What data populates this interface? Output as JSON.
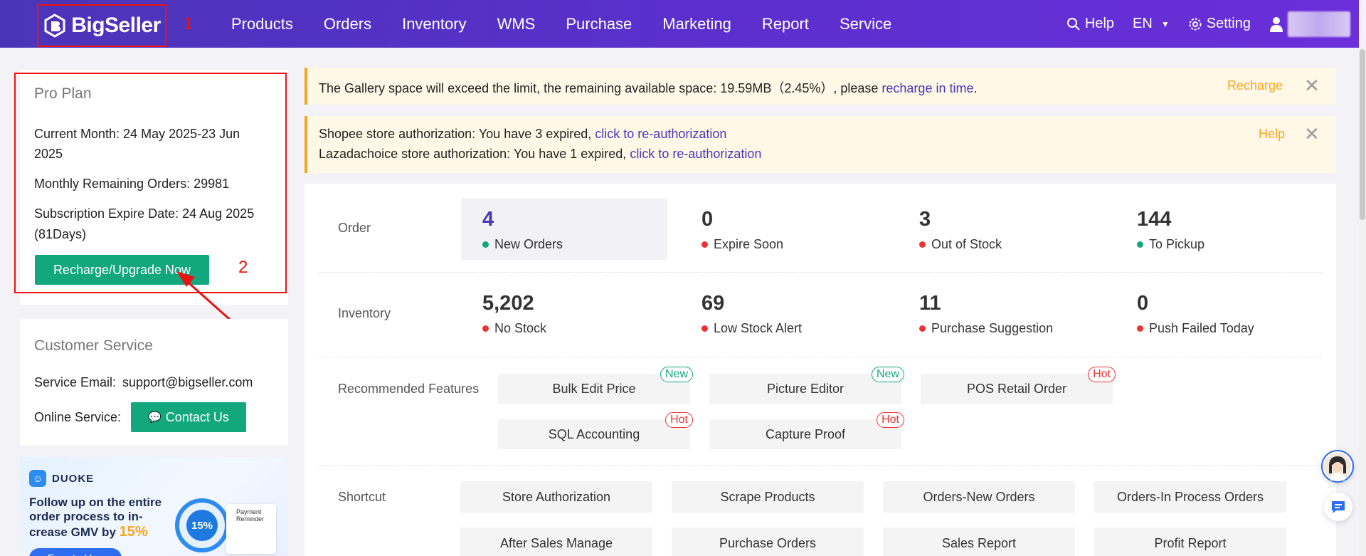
{
  "header": {
    "logo": "BigSeller",
    "annotation_1": "1",
    "nav": [
      "Products",
      "Orders",
      "Inventory",
      "WMS",
      "Purchase",
      "Marketing",
      "Report",
      "Service"
    ],
    "help": "Help",
    "lang": "EN",
    "setting": "Setting"
  },
  "plan": {
    "title": "Pro Plan",
    "current_month_1": "Current Month: 24 May 2025-23 Jun",
    "current_month_2": "2025",
    "remaining_orders": "Monthly Remaining Orders: 29981",
    "expire_1": "Subscription Expire Date: 24 Aug 2025",
    "expire_2": "(81Days)",
    "button": "Recharge/Upgrade Now",
    "annotation_2": "2"
  },
  "customer_service": {
    "title": "Customer Service",
    "email_label": "Service Email:",
    "email": "support@bigseller.com",
    "online_label": "Online Service:",
    "contact_button": "Contact Us"
  },
  "promo": {
    "brand": "DUOKE",
    "line1": "Follow up on the entire",
    "line2": "order process to in-",
    "line3_pre": "crease GMV by ",
    "line3_hl": "15%",
    "percent": "15%",
    "reminder_1": "Payment",
    "reminder_2": "Reminder",
    "cta": "Free to Use"
  },
  "alerts": {
    "gallery": {
      "text": "The Gallery space will exceed the limit, the remaining available space: 19.59MB（2.45%）, please ",
      "link": "recharge in time",
      "tail": ".",
      "action": "Recharge"
    },
    "store": {
      "line1_text": "Shopee store authorization: You have 3 expired, ",
      "line1_link": "click to re-authorization",
      "line2_text": "Lazadachoice store authorization: You have 1 expired, ",
      "line2_link": "click to re-authorization",
      "action": "Help"
    }
  },
  "order": {
    "label": "Order",
    "stats": [
      {
        "num": "4",
        "label": "New Orders"
      },
      {
        "num": "0",
        "label": "Expire Soon"
      },
      {
        "num": "3",
        "label": "Out of Stock"
      },
      {
        "num": "144",
        "label": "To Pickup"
      }
    ]
  },
  "inventory": {
    "label": "Inventory",
    "stats": [
      {
        "num": "5,202",
        "label": "No Stock"
      },
      {
        "num": "69",
        "label": "Low Stock Alert"
      },
      {
        "num": "11",
        "label": "Purchase Suggestion"
      },
      {
        "num": "0",
        "label": "Push Failed Today"
      }
    ]
  },
  "features": {
    "label": "Recommended Features",
    "items": [
      {
        "name": "Bulk Edit Price",
        "badge": "New"
      },
      {
        "name": "Picture Editor",
        "badge": "New"
      },
      {
        "name": "POS Retail Order",
        "badge": "Hot"
      },
      {
        "name": "SQL Accounting",
        "badge": "Hot"
      },
      {
        "name": "Capture Proof",
        "badge": "Hot"
      }
    ]
  },
  "shortcut": {
    "label": "Shortcut",
    "items": [
      "Store Authorization",
      "Scrape Products",
      "Orders-New Orders",
      "Orders-In Process Orders",
      "After Sales Manage",
      "Purchase Orders",
      "Sales Report",
      "Profit Report"
    ]
  },
  "colors": {
    "header": "#5a2fcc",
    "green": "#13a77e",
    "red": "#e33",
    "orange": "#f5a623",
    "accent": "#4a35b8"
  }
}
